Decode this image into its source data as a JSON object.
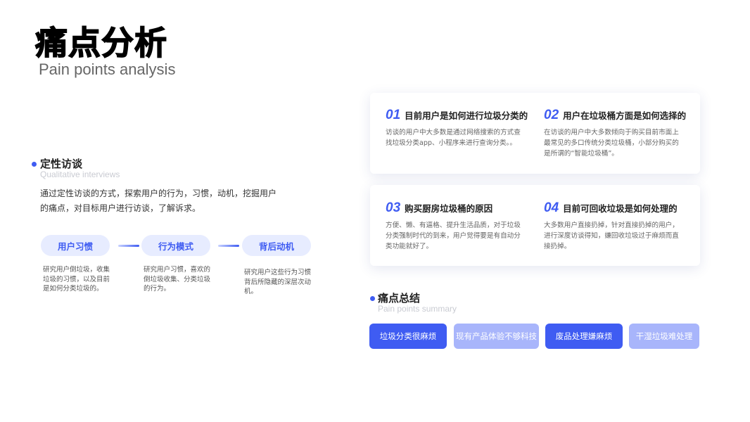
{
  "header": {
    "title": "痛点分析",
    "subtitle": "Pain points analysis"
  },
  "qualitative": {
    "title": "定性访谈",
    "subtitle": "Qualitative interviews",
    "intro": "通过定性访谈的方式，探索用户的行为，习惯，动机，挖掘用户的痛点，对目标用户进行访谈，了解诉求。",
    "steps": [
      {
        "label": "用户习惯",
        "desc": "研究用户倒垃圾，收集垃圾的习惯，以及目前是如何分类垃圾的。"
      },
      {
        "label": "行为模式",
        "desc": "研究用户习惯，喜欢的倒垃圾收集、分类垃圾的行为。"
      },
      {
        "label": "背后动机",
        "desc": "研究用户这些行为习惯背后所隐藏的深层次动机。"
      }
    ]
  },
  "questions": [
    {
      "num": "01",
      "title": "目前用户是如何进行垃圾分类的",
      "text": "访谈的用户中大多数是通过网络搜索的方式查找垃圾分类app、小程序来进行查询分类。。"
    },
    {
      "num": "02",
      "title": "用户在垃圾桶方面是如何选择的",
      "text": "在访谈的用户中大多数倾向于购买目前市面上最常见的多口传统分类垃圾桶，小部分购买的是所谓的“智能垃圾桶”。"
    },
    {
      "num": "03",
      "title": "购买厨房垃圾桶的原因",
      "text": "方便、懒、有逼格、提升生活品质，对于垃圾分类强制时代的到来，用户觉得要是有自动分类功能就好了。"
    },
    {
      "num": "04",
      "title": "目前可回收垃圾是如何处理的",
      "text": "大多数用户直接扔掉，针对直接扔掉的用户，进行深度访谈得知，嫌回收垃圾过于麻烦而直接扔掉。"
    }
  ],
  "summary": {
    "title": "痛点总结",
    "subtitle": "Pain points summary",
    "tags": [
      "垃圾分类很麻烦",
      "现有产品体验不够科技",
      "废品处理嫌麻烦",
      "干湿垃圾难处理"
    ]
  },
  "colors": {
    "accent": "#3f5cf2",
    "accent_light": "#a8b5fb",
    "pill_bg": "#e7ecff"
  }
}
